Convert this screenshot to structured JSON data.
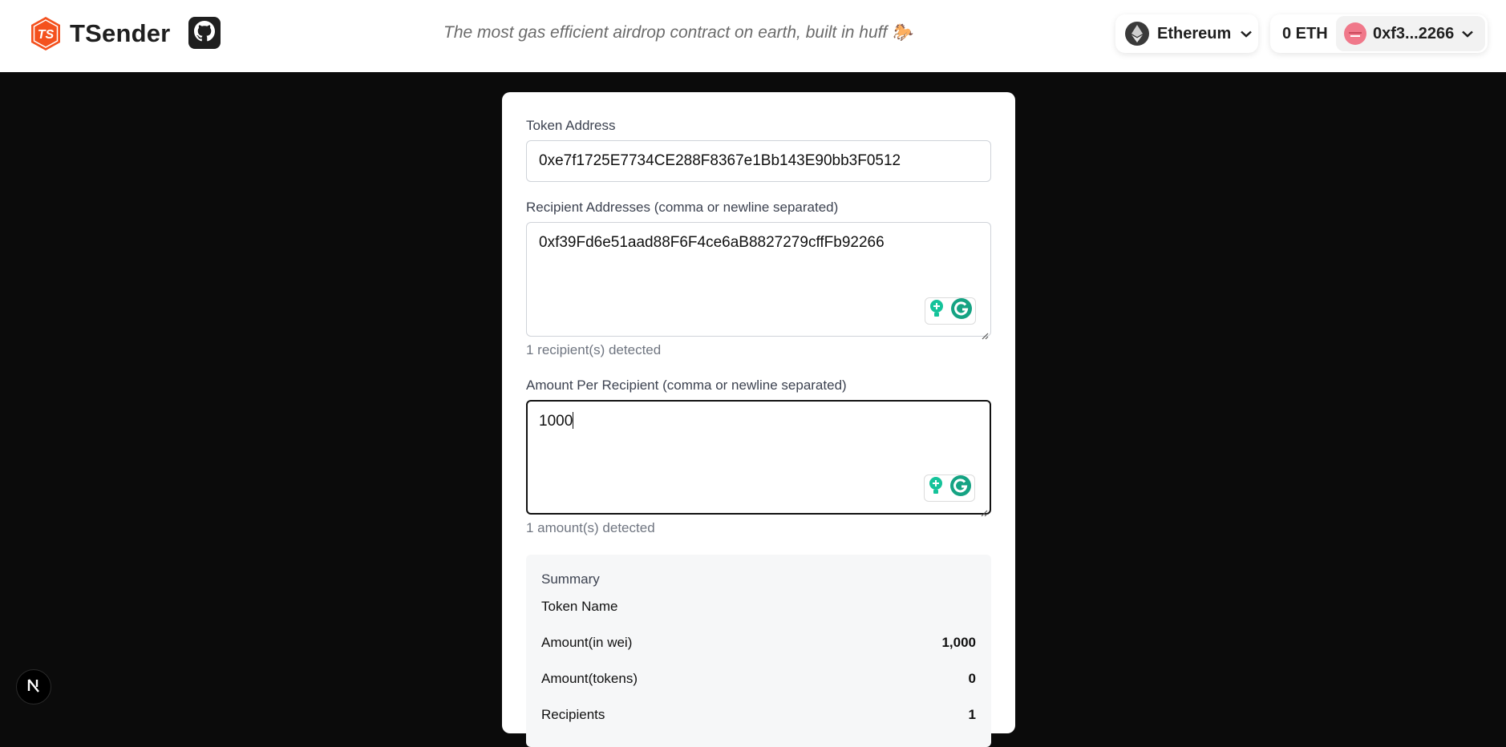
{
  "header": {
    "brand_name": "TSender",
    "logo_text": "TS",
    "tagline": "The most gas efficient airdrop contract on earth, built in huff 🐎",
    "network_label": "Ethereum",
    "balance": "0 ETH",
    "account_label": "0xf3...2266"
  },
  "form": {
    "token_address_label": "Token Address",
    "token_address_value": "0xe7f1725E7734CE288F8367e1Bb143E90bb3F0512",
    "recipients_label": "Recipient Addresses (comma or newline separated)",
    "recipients_value": "0xf39Fd6e51aad88F6F4ce6aB8827279cffFb92266",
    "recipients_hint": "1 recipient(s) detected",
    "amounts_label": "Amount Per Recipient (comma or newline separated)",
    "amounts_value": "1000",
    "amounts_hint": "1 amount(s) detected"
  },
  "summary": {
    "title": "Summary",
    "rows": [
      {
        "key": "Token Name",
        "value": ""
      },
      {
        "key": "Amount(in wei)",
        "value": "1,000"
      },
      {
        "key": "Amount(tokens)",
        "value": "0"
      },
      {
        "key": "Recipients",
        "value": "1"
      }
    ]
  },
  "colors": {
    "logo_orange": "#f4511e",
    "page_background": "#0b0b0b",
    "grammarly_green": "#15c39a"
  }
}
